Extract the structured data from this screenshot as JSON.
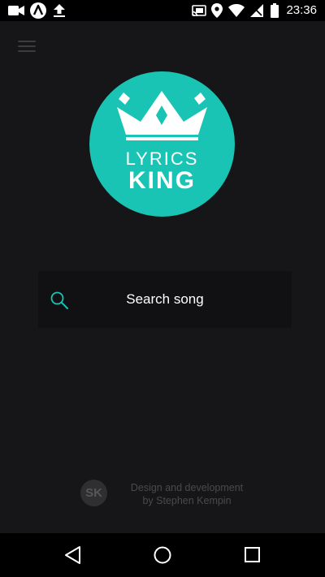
{
  "status_bar": {
    "time": "23:36",
    "left_icons": [
      "video-camera-icon",
      "app-notification-icon",
      "upload-icon"
    ],
    "right_icons": [
      "cast-icon",
      "location-icon",
      "wifi-icon",
      "no-signal-icon",
      "battery-icon"
    ]
  },
  "app": {
    "menu_icon": "hamburger-menu-icon",
    "logo": {
      "line1": "LYRICS",
      "line2": "KING",
      "color": "#19c4b4"
    },
    "search": {
      "icon": "search-icon",
      "label": "Search song",
      "accent": "#19c4b4"
    },
    "credit": {
      "initials": "SK",
      "line1": "Design and development",
      "line2": "by Stephen Kempin"
    }
  },
  "nav_bar": {
    "buttons": [
      "back-icon",
      "home-icon",
      "recents-icon"
    ]
  }
}
